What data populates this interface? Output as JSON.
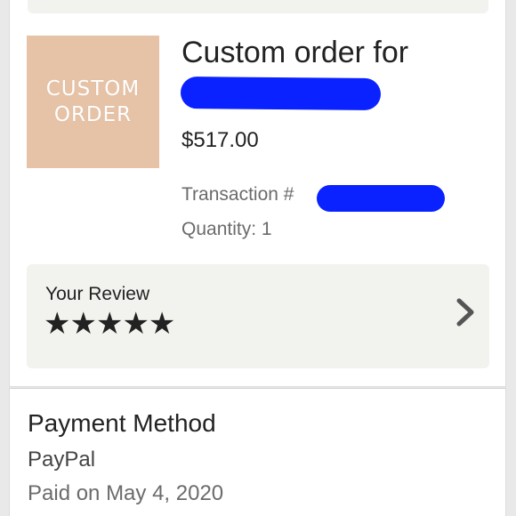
{
  "item": {
    "thumbnail_lines": [
      "CUSTOM",
      "ORDER"
    ],
    "title": "Custom order for",
    "price": "$517.00",
    "transaction_label": "Transaction #",
    "quantity": "Quantity: 1"
  },
  "review": {
    "label": "Your Review",
    "stars": "★★★★★",
    "rating": 5,
    "rating_max": 5
  },
  "payment": {
    "title": "Payment Method",
    "method": "PayPal",
    "paid_on": "Paid on May 4, 2020"
  },
  "colors": {
    "redaction": "#0a22ff",
    "thumbnail_bg": "#e6c2a6",
    "panel_bg": "#f2f2ef"
  }
}
